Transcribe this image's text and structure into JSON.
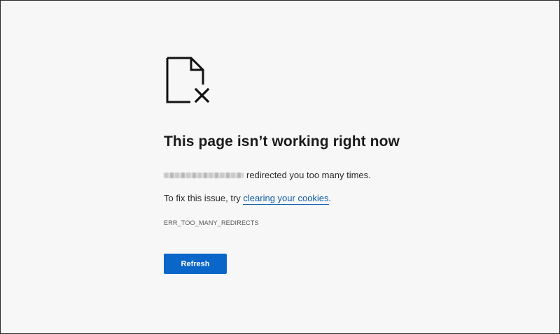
{
  "error": {
    "icon": "broken-document-icon",
    "title": "This page isn’t working right now",
    "redirect_message": "redirected you too many times.",
    "fix_prefix": "To fix this issue, try ",
    "fix_link": "clearing your cookies",
    "fix_suffix": ".",
    "code": "ERR_TOO_MANY_REDIRECTS"
  },
  "actions": {
    "refresh_label": "Refresh"
  },
  "colors": {
    "background": "#f7f7f7",
    "link": "#0b5aa8",
    "button": "#0a66c9"
  }
}
